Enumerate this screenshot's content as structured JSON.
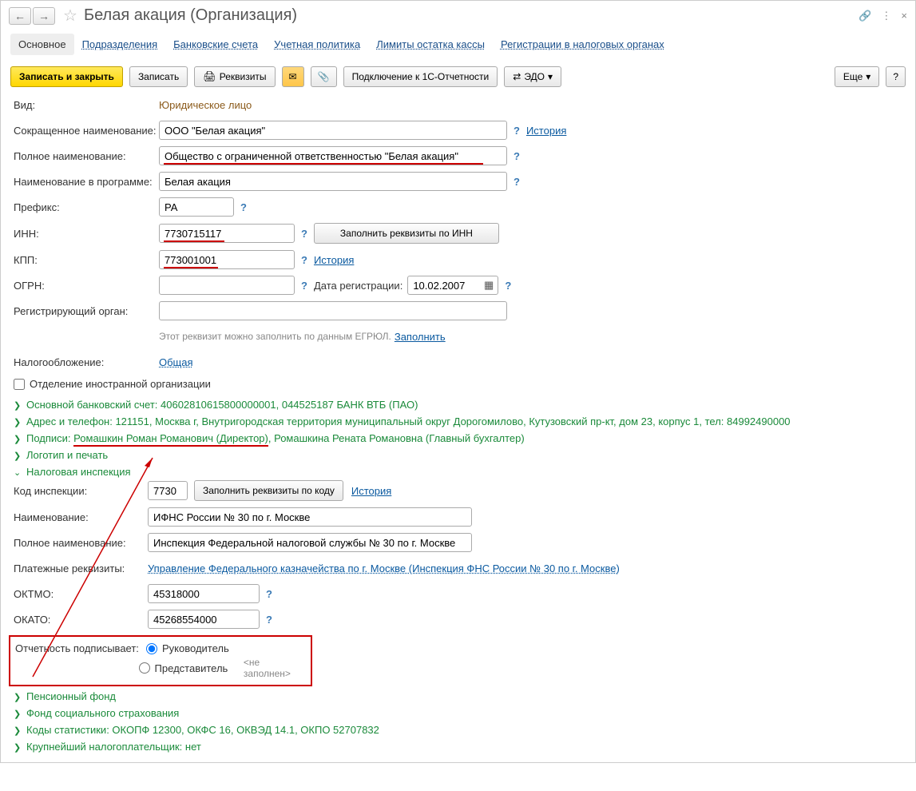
{
  "title": "Белая акация (Организация)",
  "tabs": [
    "Основное",
    "Подразделения",
    "Банковские счета",
    "Учетная политика",
    "Лимиты остатка кассы",
    "Регистрации в налоговых органах"
  ],
  "toolbar": {
    "save_close": "Записать и закрыть",
    "save": "Записать",
    "details": "Реквизиты",
    "connect_1c": "Подключение к 1С-Отчетности",
    "edo": "ЭДО",
    "more": "Еще"
  },
  "form": {
    "vid_label": "Вид:",
    "vid_value": "Юридическое лицо",
    "short_name_label": "Сокращенное наименование:",
    "short_name_value": "ООО \"Белая акация\"",
    "history_link": "История",
    "full_name_label": "Полное наименование:",
    "full_name_value": "Общество с ограниченной ответственностью \"Белая акация\"",
    "prog_name_label": "Наименование в программе:",
    "prog_name_value": "Белая акация",
    "prefix_label": "Префикс:",
    "prefix_value": "РА",
    "inn_label": "ИНН:",
    "inn_value": "7730715117",
    "fill_inn_btn": "Заполнить реквизиты по ИНН",
    "kpp_label": "КПП:",
    "kpp_value": "773001001",
    "ogrn_label": "ОГРН:",
    "ogrn_value": "",
    "reg_date_label": "Дата регистрации:",
    "reg_date_value": "10.02.2007",
    "reg_org_label": "Регистрирующий орган:",
    "reg_org_value": "",
    "egrul_hint": "Этот реквизит можно заполнить по данным ЕГРЮЛ.",
    "fill_link": "Заполнить",
    "tax_label": "Налогообложение:",
    "tax_value": "Общая",
    "foreign_cb": "Отделение иностранной организации"
  },
  "sections": {
    "bank": "Основной банковский счет: 40602810615800000001, 044525187 БАНК ВТБ (ПАО)",
    "address": "Адрес и телефон: 121151, Москва г, Внутригородская территория муниципальный округ Дорогомилово, Кутузовский пр-кт, дом 23, корпус 1, тел: 84992490000",
    "signatures_prefix": "Подписи: ",
    "signatures_underlined": "Ромашкин Роман Романович (Директор)",
    "signatures_rest": ", Ромашкина Рената Романовна (Главный бухгалтер)",
    "logo": "Логотип и печать",
    "tax_inspection": "Налоговая инспекция",
    "pension": "Пенсионный фонд",
    "fss": "Фонд социального страхования",
    "stats": "Коды статистики: ОКОПФ 12300, ОКФС 16, ОКВЭД 14.1, ОКПО 52707832",
    "largest": "Крупнейший налогоплательщик: нет"
  },
  "inspection": {
    "code_label": "Код инспекции:",
    "code_value": "7730",
    "fill_code_btn": "Заполнить реквизиты по коду",
    "name_label": "Наименование:",
    "name_value": "ИФНС России № 30 по г. Москве",
    "full_name_label": "Полное наименование:",
    "full_name_value": "Инспекция Федеральной налоговой службы № 30 по г. Москве",
    "payment_label": "Платежные реквизиты:",
    "payment_link": "Управление Федерального казначейства по г. Москве (Инспекция ФНС России № 30 по г. Москве)",
    "oktmo_label": "ОКТМО:",
    "oktmo_value": "45318000",
    "okato_label": "ОКАТО:",
    "okato_value": "45268554000",
    "signs_label": "Отчетность подписывает:",
    "opt1": "Руководитель",
    "opt2": "Представитель",
    "not_filled": "<не заполнен>"
  }
}
